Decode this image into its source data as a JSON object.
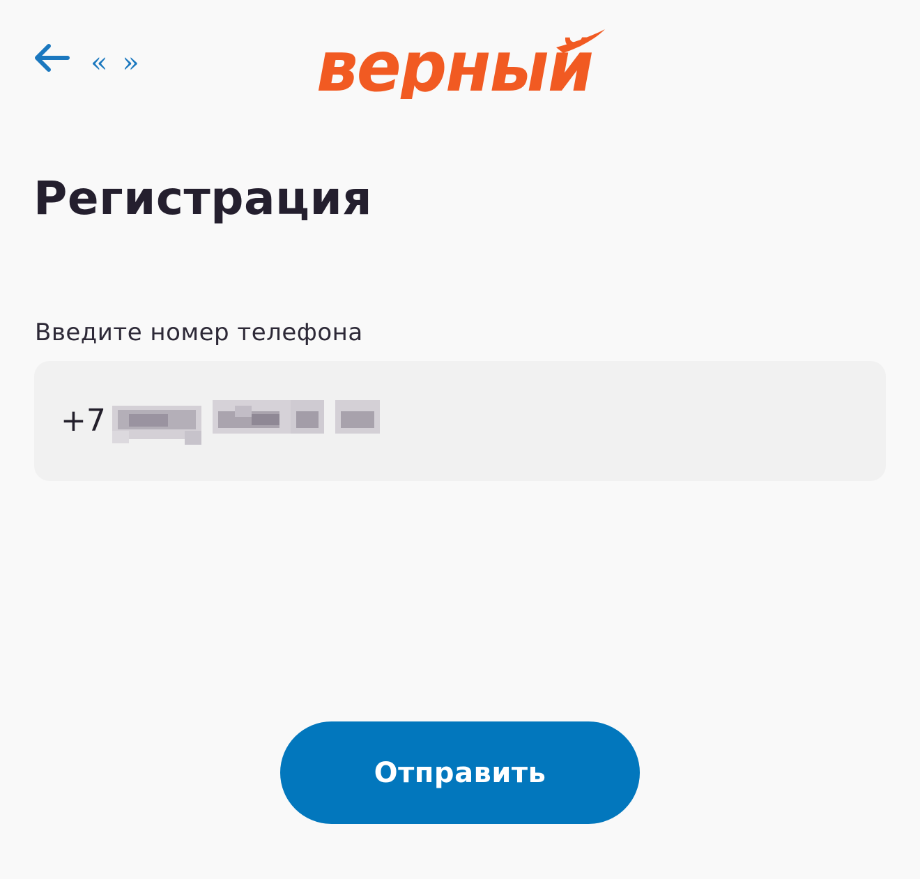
{
  "header": {
    "back_icon": "arrow-left-icon",
    "quotes_text": "« »",
    "logo_text": "верный"
  },
  "page": {
    "title": "Регистрация"
  },
  "phone": {
    "label": "Введите номер телефона",
    "prefix": "+7"
  },
  "actions": {
    "submit_label": "Отправить"
  },
  "colors": {
    "background": "#f9f9f9",
    "accent_blue": "#0277bd",
    "logo_orange": "#f15a22",
    "title_text": "#241f2e",
    "field_background": "#f1f1f1"
  }
}
